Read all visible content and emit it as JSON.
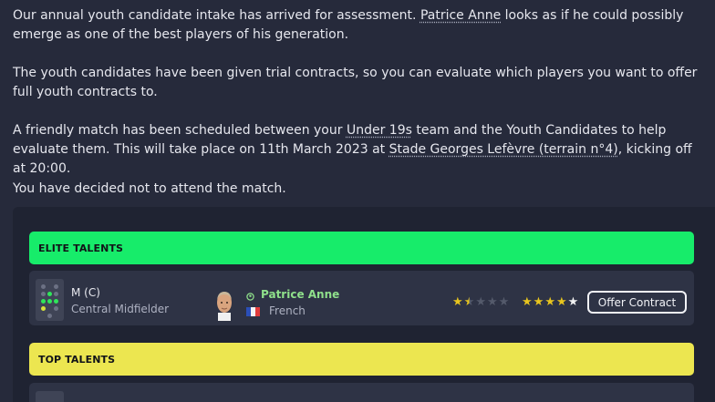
{
  "message": {
    "p1_a": "Our annual youth candidate intake has arrived for assessment. ",
    "p1_player": "Patrice Anne",
    "p1_b": " looks as if he could possibly emerge as one of the best players of his generation.",
    "p2": "The youth candidates have been given trial contracts, so you can evaluate which players you want to offer full youth contracts to.",
    "p3_a": "A friendly match has been scheduled between your ",
    "p3_team": "Under 19s",
    "p3_b": " team and the Youth Candidates to help evaluate them. This will take place on 11th March 2023 at ",
    "p3_venue": "Stade Georges Lefèvre (terrain n°4)",
    "p3_c": ", kicking off at 20:00.",
    "p4": "You have decided not to attend the match."
  },
  "groups": [
    {
      "label": "ELITE TALENTS",
      "color": "#17ec6a",
      "players": [
        {
          "position_code": "M (C)",
          "position_name": "Central Midfielder",
          "name": "Patrice Anne",
          "nationality": "French",
          "current_ability_stars": 1.5,
          "potential_ability_stars": 5,
          "action_label": "Offer Contract"
        }
      ]
    },
    {
      "label": "TOP TALENTS",
      "color": "#ece650",
      "players": []
    }
  ],
  "icons": {
    "formation": "pitch-position-icon",
    "face": "player-face-icon",
    "player_type": "player-status-icon",
    "flag": "france-flag-icon",
    "star": "star-icon"
  },
  "colors": {
    "background": "#262a3b",
    "panel": "#1f2332",
    "row": "#2e3345",
    "player_name": "#8fe08b",
    "star": "#e8c51e"
  }
}
